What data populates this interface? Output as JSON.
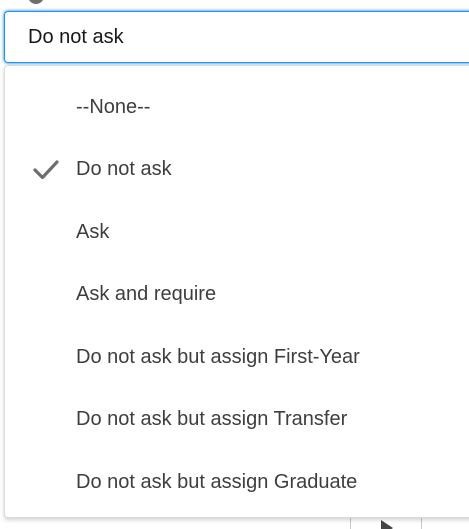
{
  "field": {
    "selected_value": "Do not ask"
  },
  "listbox": {
    "options": [
      {
        "label": "--None--",
        "selected": false
      },
      {
        "label": "Do not ask",
        "selected": true
      },
      {
        "label": "Ask",
        "selected": false
      },
      {
        "label": "Ask and require",
        "selected": false
      },
      {
        "label": "Do not ask but assign First-Year",
        "selected": false
      },
      {
        "label": "Do not ask but assign Transfer",
        "selected": false
      },
      {
        "label": "Do not ask but assign Graduate",
        "selected": false
      }
    ],
    "check_icon": "checkmark-icon"
  },
  "colors": {
    "focus_border": "#1b96ff",
    "text": "#3e3e3c",
    "check": "#706e6b"
  },
  "icons": {
    "help": "help-icon",
    "play": "play-icon"
  }
}
